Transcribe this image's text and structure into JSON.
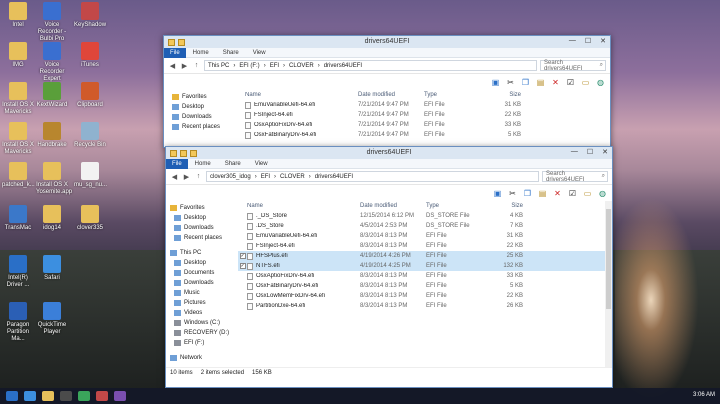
{
  "desktop_icons": [
    {
      "label": "Intel",
      "icon": "folder-icon",
      "color": "#e7c05b"
    },
    {
      "label": "Voice Recorder - Bulbi Pro",
      "icon": "recorder-icon",
      "color": "#3a6fd0"
    },
    {
      "label": "KeyShadow",
      "icon": "app-icon",
      "color": "#c24848"
    },
    {
      "label": "IMG",
      "icon": "folder-icon",
      "color": "#e7c05b"
    },
    {
      "label": "Voice Recorder Expert",
      "icon": "recorder-icon",
      "color": "#3a6fd0"
    },
    {
      "label": "iTunes",
      "icon": "itunes-icon",
      "color": "#e0463a"
    },
    {
      "label": "Install OS X Mavericks",
      "icon": "folder-icon",
      "color": "#e7c05b"
    },
    {
      "label": "KextWizard",
      "icon": "wizard-icon",
      "color": "#5a9f3a"
    },
    {
      "label": "Clipboard",
      "icon": "clipboard-icon",
      "color": "#d05a2a"
    },
    {
      "label": "Install OS X Mavericks",
      "icon": "folder-icon",
      "color": "#e7c05b"
    },
    {
      "label": "Handbrake",
      "icon": "handbrake-icon",
      "color": "#b8862e"
    },
    {
      "label": "Recycle Bin",
      "icon": "recycle-bin-icon",
      "color": "#8fb2cf"
    },
    {
      "label": "patched_k...",
      "icon": "folder-icon",
      "color": "#e7c05b"
    },
    {
      "label": "Install OS X Yosemite.app",
      "icon": "folder-icon",
      "color": "#e7c05b"
    },
    {
      "label": "mu_sg_nu...",
      "icon": "file-icon",
      "color": "#f2f2f2"
    },
    {
      "label": "TransMac",
      "icon": "transmac-icon",
      "color": "#3b78c9"
    },
    {
      "label": "idog14",
      "icon": "folder-icon",
      "color": "#e7c05b"
    },
    {
      "label": "clover335",
      "icon": "folder-icon",
      "color": "#e7c05b"
    },
    {
      "label": "Intel(R) Driver ...",
      "icon": "intel-icon",
      "color": "#2a6fc7"
    },
    {
      "label": "Safari",
      "icon": "safari-icon",
      "color": "#3c8fe0"
    },
    {
      "label": "Paragon Partition Ma...",
      "icon": "paragon-icon",
      "color": "#2b5fb5"
    },
    {
      "label": "QuickTime Player",
      "icon": "quicktime-icon",
      "color": "#3b7fd9"
    }
  ],
  "back_window": {
    "title": "drivers64UEFI",
    "ribbon": {
      "file": "File",
      "tabs": [
        "Home",
        "Share",
        "View"
      ]
    },
    "breadcrumb": [
      "This PC",
      "EFI (F:)",
      "EFI",
      "CLOVER",
      "drivers64UEFI"
    ],
    "search_placeholder": "Search drivers64UEFI",
    "nav": [
      "Favorites",
      "Desktop",
      "Downloads",
      "Recent places"
    ],
    "columns": [
      "Name",
      "Date modified",
      "Type",
      "Size"
    ],
    "files": [
      {
        "name": "EmuVariableUefi-64.efi",
        "date": "7/21/2014 9:47 PM",
        "type": "EFI File",
        "size": "31 KB"
      },
      {
        "name": "FSInject-64.efi",
        "date": "7/21/2014 9:47 PM",
        "type": "EFI File",
        "size": "22 KB"
      },
      {
        "name": "OsxAptioFixDrv-64.efi",
        "date": "7/21/2014 9:47 PM",
        "type": "EFI File",
        "size": "33 KB"
      },
      {
        "name": "OsxFatBinaryDrv-64.efi",
        "date": "7/21/2014 9:47 PM",
        "type": "EFI File",
        "size": "5 KB"
      }
    ]
  },
  "front_window": {
    "title": "drivers64UEFI",
    "ribbon": {
      "file": "File",
      "tabs": [
        "Home",
        "Share",
        "View"
      ]
    },
    "breadcrumb": [
      "clover305_idog",
      "EFI",
      "CLOVER",
      "drivers64UEFI"
    ],
    "search_placeholder": "Search drivers64UEFI",
    "nav": [
      {
        "label": "Favorites",
        "icon": "star-icon"
      },
      {
        "label": "Desktop",
        "icon": "desktop-icon"
      },
      {
        "label": "Downloads",
        "icon": "downloads-icon"
      },
      {
        "label": "Recent places",
        "icon": "recent-icon"
      },
      {
        "label": "This PC",
        "icon": "computer-icon"
      },
      {
        "label": "Desktop",
        "icon": "desktop-icon"
      },
      {
        "label": "Documents",
        "icon": "documents-icon"
      },
      {
        "label": "Downloads",
        "icon": "downloads-icon"
      },
      {
        "label": "Music",
        "icon": "music-icon"
      },
      {
        "label": "Pictures",
        "icon": "pictures-icon"
      },
      {
        "label": "Videos",
        "icon": "videos-icon"
      },
      {
        "label": "Windows (C:)",
        "icon": "drive-icon"
      },
      {
        "label": "RECOVERY (D:)",
        "icon": "drive-icon"
      },
      {
        "label": "EFI (F:)",
        "icon": "drive-icon"
      },
      {
        "label": "Network",
        "icon": "network-icon"
      }
    ],
    "columns": [
      "Name",
      "Date modified",
      "Type",
      "Size"
    ],
    "files": [
      {
        "name": "._DS_Store",
        "date": "12/15/2014 6:12 PM",
        "type": "DS_STORE File",
        "size": "4 KB",
        "selected": false
      },
      {
        "name": ".DS_Store",
        "date": "4/5/2014 2:53 PM",
        "type": "DS_STORE File",
        "size": "7 KB",
        "selected": false
      },
      {
        "name": "EmuVariableUefi-64.efi",
        "date": "8/3/2014 8:13 PM",
        "type": "EFI File",
        "size": "31 KB",
        "selected": false
      },
      {
        "name": "FSInject-64.efi",
        "date": "8/3/2014 8:13 PM",
        "type": "EFI File",
        "size": "22 KB",
        "selected": false
      },
      {
        "name": "HFSPlus.efi",
        "date": "4/19/2014 4:26 PM",
        "type": "EFI File",
        "size": "25 KB",
        "selected": true
      },
      {
        "name": "NTFS.efi",
        "date": "4/19/2014 4:25 PM",
        "type": "EFI File",
        "size": "132 KB",
        "selected": true
      },
      {
        "name": "OsxAptioFixDrv-64.efi",
        "date": "8/3/2014 8:13 PM",
        "type": "EFI File",
        "size": "33 KB",
        "selected": false
      },
      {
        "name": "OsxFatBinaryDrv-64.efi",
        "date": "8/3/2014 8:13 PM",
        "type": "EFI File",
        "size": "5 KB",
        "selected": false
      },
      {
        "name": "OsxLowMemFixDrv-64.efi",
        "date": "8/3/2014 8:13 PM",
        "type": "EFI File",
        "size": "22 KB",
        "selected": false
      },
      {
        "name": "PartitionDxe-64.efi",
        "date": "8/3/2014 8:13 PM",
        "type": "EFI File",
        "size": "26 KB",
        "selected": false
      }
    ],
    "status": {
      "items": "10 items",
      "selected": "2 items selected",
      "size": "156 KB"
    }
  },
  "taskbar": {
    "clock": "3:06 AM"
  }
}
